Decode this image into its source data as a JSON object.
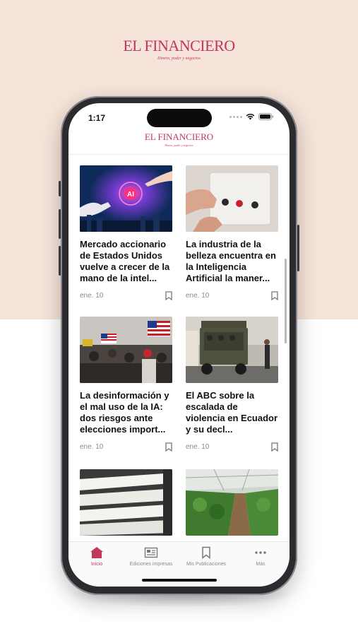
{
  "brand": {
    "logo": "EL FINANCIERO",
    "tagline": "Dinero, poder y negocios"
  },
  "status_bar": {
    "time": "1:17"
  },
  "app_header": {
    "logo": "EL FINANCIERO",
    "tagline": "Dinero, poder y negocios"
  },
  "articles": [
    {
      "title": "Mercado accionario de Estados Unidos vuelve a crecer de la mano de la intel...",
      "date": "ene. 10",
      "image": "ai-robot-hand-image"
    },
    {
      "title": "La industria de la belleza encuentra en la Inteligencia Artificial la maner...",
      "date": "ene. 10",
      "image": "beauty-device-image"
    },
    {
      "title": "La desinformación y el mal uso de la IA: dos riesgos ante elecciones import...",
      "date": "ene. 10",
      "image": "protest-flags-image"
    },
    {
      "title": "El ABC sobre la escalada de violencia en Ecuador y su decl...",
      "date": "ene. 10",
      "image": "military-truck-image"
    },
    {
      "title": "",
      "date": "",
      "image": "papers-stack-image"
    },
    {
      "title": "",
      "date": "",
      "image": "greenhouse-image"
    }
  ],
  "tabs": [
    {
      "label": "Inicio",
      "icon": "home-icon",
      "active": true
    },
    {
      "label": "Ediciones impresas",
      "icon": "newspaper-icon",
      "active": false
    },
    {
      "label": "Mis Publicaciones",
      "icon": "bookmark-icon",
      "active": false
    },
    {
      "label": "Más",
      "icon": "more-icon",
      "active": false
    }
  ],
  "colors": {
    "brand": "#c0385a",
    "background_top": "#f6e4da"
  }
}
